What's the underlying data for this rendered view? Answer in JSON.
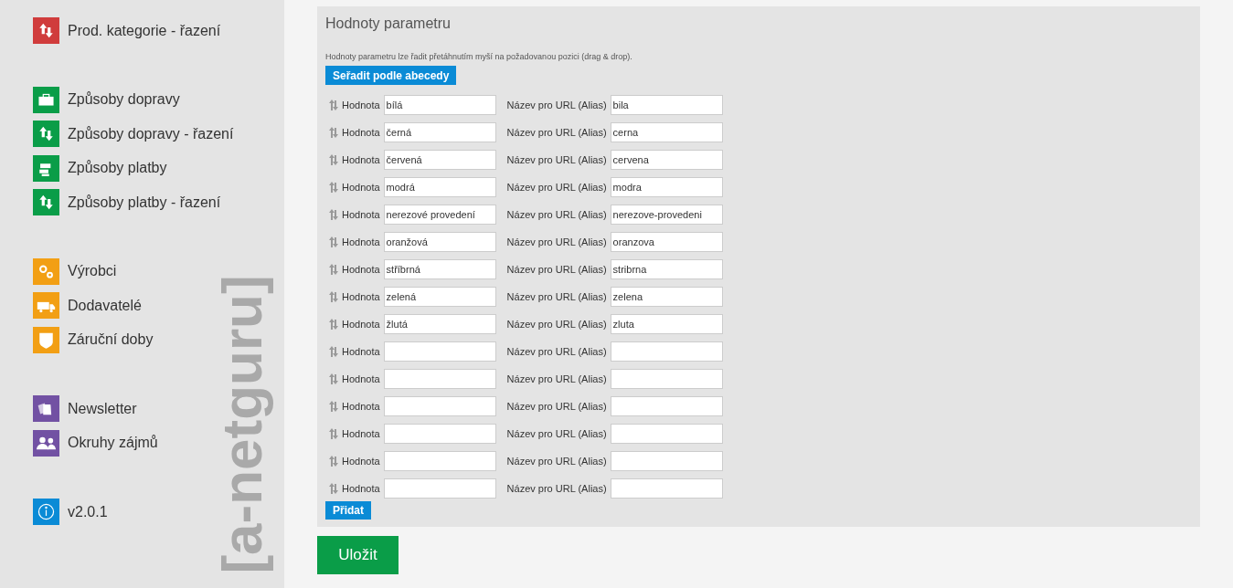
{
  "sidebar": {
    "logo": "[a-netguru]",
    "groups": [
      {
        "items": [
          {
            "label": "Prod. kategorie - řazení",
            "color": "#d03c3c"
          }
        ]
      },
      {
        "items": [
          {
            "label": "Způsoby dopravy",
            "color": "#0a9d48"
          },
          {
            "label": "Způsoby dopravy - řazení",
            "color": "#0a9d48"
          },
          {
            "label": "Způsoby platby",
            "color": "#0a9d48"
          },
          {
            "label": "Způsoby platby - řazení",
            "color": "#0a9d48"
          }
        ]
      },
      {
        "items": [
          {
            "label": "Výrobci",
            "color": "#f29f14"
          },
          {
            "label": "Dodavatelé",
            "color": "#f29f14"
          },
          {
            "label": "Záruční doby",
            "color": "#f29f14"
          }
        ]
      },
      {
        "items": [
          {
            "label": "Newsletter",
            "color": "#7251a3"
          },
          {
            "label": "Okruhy zájmů",
            "color": "#7251a3"
          }
        ]
      },
      {
        "items": [
          {
            "label": "v2.0.1",
            "color": "#0a8bd6"
          }
        ]
      }
    ]
  },
  "panel": {
    "title": "Hodnoty parametru",
    "hint": "Hodnoty parametru lze řadit přetáhnutím myší na požadovanou pozici (drag & drop).",
    "sort_button": "Seřadit podle abecedy",
    "add_button": "Přidat",
    "rows": [
      {
        "value_label": "Hodnota",
        "value": "bílá",
        "alias_label": "Název pro URL (Alias)",
        "alias": "bila"
      },
      {
        "value_label": "Hodnota",
        "value": "černá",
        "alias_label": "Název pro URL (Alias)",
        "alias": "cerna"
      },
      {
        "value_label": "Hodnota",
        "value": "červená",
        "alias_label": "Název pro URL (Alias)",
        "alias": "cervena"
      },
      {
        "value_label": "Hodnota",
        "value": "modrá",
        "alias_label": "Název pro URL (Alias)",
        "alias": "modra"
      },
      {
        "value_label": "Hodnota",
        "value": "nerezové provedení",
        "alias_label": "Název pro URL (Alias)",
        "alias": "nerezove-provedeni"
      },
      {
        "value_label": "Hodnota",
        "value": "oranžová",
        "alias_label": "Název pro URL (Alias)",
        "alias": "oranzova"
      },
      {
        "value_label": "Hodnota",
        "value": "stříbrná",
        "alias_label": "Název pro URL (Alias)",
        "alias": "stribrna"
      },
      {
        "value_label": "Hodnota",
        "value": "zelená",
        "alias_label": "Název pro URL (Alias)",
        "alias": "zelena"
      },
      {
        "value_label": "Hodnota",
        "value": "žlutá",
        "alias_label": "Název pro URL (Alias)",
        "alias": "zluta"
      },
      {
        "value_label": "Hodnota",
        "alias_label": "Název pro URL (Alias)"
      },
      {
        "value_label": "Hodnota",
        "alias_label": "Název pro URL (Alias)"
      },
      {
        "value_label": "Hodnota",
        "alias_label": "Název pro URL (Alias)"
      },
      {
        "value_label": "Hodnota",
        "alias_label": "Název pro URL (Alias)"
      },
      {
        "value_label": "Hodnota",
        "alias_label": "Název pro URL (Alias)"
      },
      {
        "value_label": "Hodnota",
        "alias_label": "Název pro URL (Alias)"
      }
    ]
  },
  "save_button": "Uložit"
}
